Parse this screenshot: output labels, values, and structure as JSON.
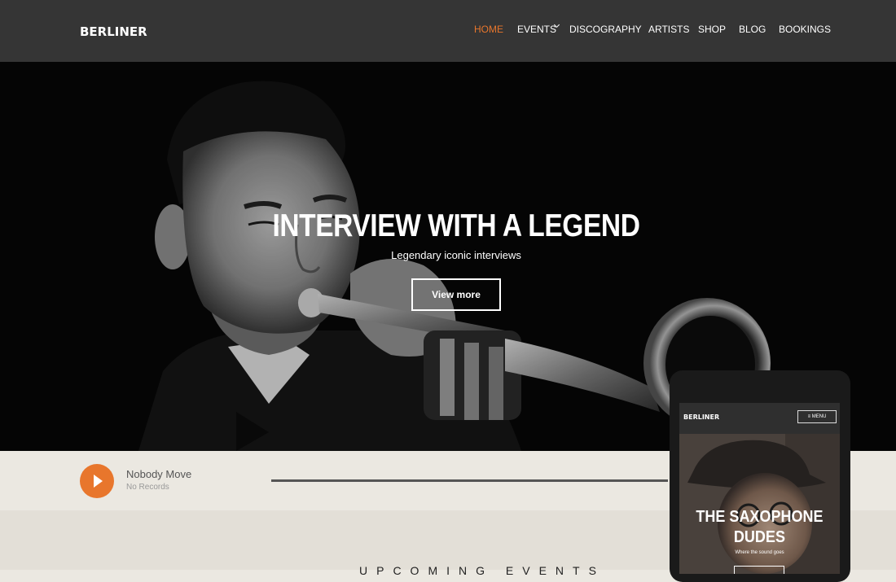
{
  "header": {
    "logo": "BERLINER",
    "nav": [
      {
        "label": "HOME",
        "active": true
      },
      {
        "label": "EVENTS",
        "active": false,
        "has_dropdown": true
      },
      {
        "label": "DISCOGRAPHY",
        "active": false
      },
      {
        "label": "ARTISTS",
        "active": false
      },
      {
        "label": "SHOP",
        "active": false
      },
      {
        "label": "BLOG",
        "active": false
      },
      {
        "label": "BOOKINGS",
        "active": false
      }
    ]
  },
  "hero": {
    "title": "INTERVIEW WITH A LEGEND",
    "subtitle": "Legendary iconic interviews",
    "button_label": "View more"
  },
  "player": {
    "track_title": "Nobody Move",
    "track_subtitle": "No Records",
    "play_icon": "play-icon"
  },
  "events": {
    "title": "UPCOMING EVENTS"
  },
  "mobile_preview": {
    "logo": "BERLINER",
    "menu_label": "≡ MENU",
    "title": "THE SAXOPHONE DUDES",
    "subtitle": "Where the sound goes"
  },
  "colors": {
    "accent": "#e8762c",
    "header_bg": "#353535",
    "player_bg": "#ebe8e1"
  }
}
